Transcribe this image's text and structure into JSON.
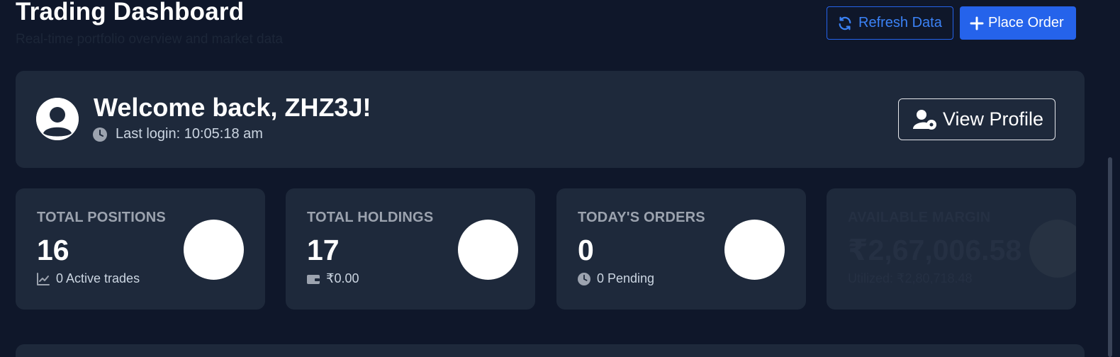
{
  "header": {
    "title": "Trading Dashboard",
    "subtitle": "Real-time portfolio overview and market data",
    "refresh_label": "Refresh Data",
    "order_label": "Place Order",
    "refresh_icon": "refresh-icon",
    "order_icon": "plus-icon"
  },
  "welcome": {
    "title": "Welcome back, ZHZ3J!",
    "last_login": "Last login: 10:05:18 am",
    "avatar_icon": "user-avatar-icon",
    "clock_icon": "clock-icon",
    "profile_label": "View Profile",
    "profile_icon": "user-gear-icon"
  },
  "stats": [
    {
      "label": "TOTAL POSITIONS",
      "value": "16",
      "sub": "0 Active trades",
      "icon": "chart-line-icon"
    },
    {
      "label": "TOTAL HOLDINGS",
      "value": "17",
      "sub": "₹0.00",
      "icon": "wallet-icon"
    },
    {
      "label": "TODAY'S ORDERS",
      "value": "0",
      "sub": "0 Pending",
      "icon": "clock-icon"
    },
    {
      "label": "AVAILABLE MARGIN",
      "value": "₹2,67,006.58",
      "sub": "Utilized: ₹2,80,718.48",
      "icon": "none"
    }
  ],
  "colors": {
    "background": "#0f172a",
    "card": "#1e293b",
    "accent": "#2563eb",
    "muted_text": "#9ca3af"
  }
}
